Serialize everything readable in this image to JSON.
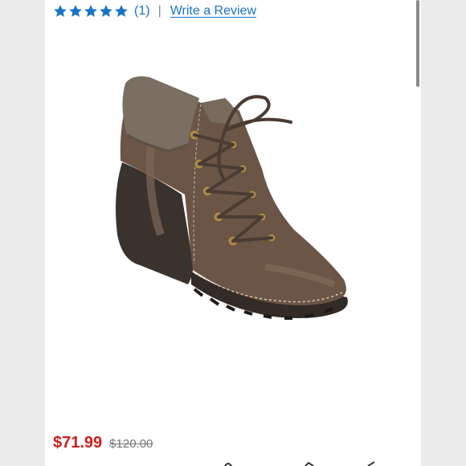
{
  "rating": {
    "stars": 5,
    "star_color": "#1a73c8",
    "count": "(1)",
    "separator": "|",
    "write_review": "Write a Review"
  },
  "product": {
    "image_icon": "ankle-boot-image",
    "sale_price": "$71.99",
    "original_price": "$120.00",
    "sale_color": "#cc1f1a"
  }
}
